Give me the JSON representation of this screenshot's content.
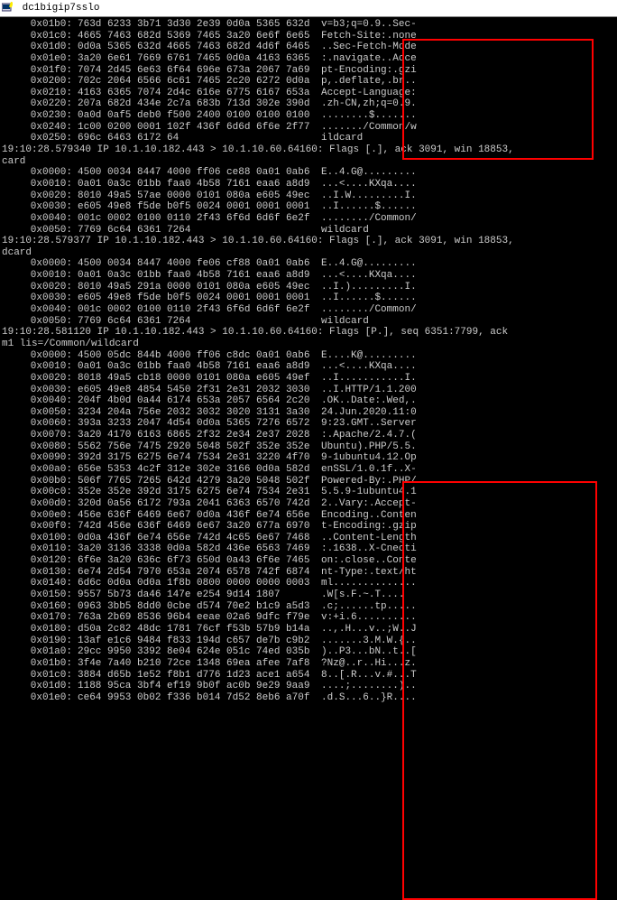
{
  "window": {
    "title": "dc1bigip7sslo"
  },
  "rows": [
    {
      "off": "0x01b0:",
      "hex": "763d 6233 3b71 3d30 2e39 0d0a 5365 632d",
      "asc": "v=b3;q=0.9..Sec-"
    },
    {
      "off": "0x01c0:",
      "hex": "4665 7463 682d 5369 7465 3a20 6e6f 6e65",
      "asc": "Fetch-Site:.none"
    },
    {
      "off": "0x01d0:",
      "hex": "0d0a 5365 632d 4665 7463 682d 4d6f 6465",
      "asc": "..Sec-Fetch-Mode"
    },
    {
      "off": "0x01e0:",
      "hex": "3a20 6e61 7669 6761 7465 0d0a 4163 6365",
      "asc": ":.navigate..Acce"
    },
    {
      "off": "0x01f0:",
      "hex": "7074 2d45 6e63 6f64 696e 673a 2067 7a69",
      "asc": "pt-Encoding:.gzi"
    },
    {
      "off": "0x0200:",
      "hex": "702c 2064 6566 6c61 7465 2c20 6272 0d0a",
      "asc": "p,.deflate,.br.."
    },
    {
      "off": "0x0210:",
      "hex": "4163 6365 7074 2d4c 616e 6775 6167 653a",
      "asc": "Accept-Language:"
    },
    {
      "off": "0x0220:",
      "hex": "207a 682d 434e 2c7a 683b 713d 302e 390d",
      "asc": ".zh-CN,zh;q=0.9."
    },
    {
      "off": "0x0230:",
      "hex": "0a0d 0af5 deb0 f500 2400 0100 0100 0100",
      "asc": "........$......."
    },
    {
      "off": "0x0240:",
      "hex": "1c00 0200 0001 102f 436f 6d6d 6f6e 2f77",
      "asc": "......./Common/w"
    },
    {
      "off": "0x0250:",
      "hex": "696c 6463 6172 64",
      "asc": "ildcard"
    },
    {
      "summary": "19:10:28.579340 IP 10.1.10.182.443 > 10.1.10.60.64160: Flags [.], ack 3091, win 18853,"
    },
    {
      "summary": "card"
    },
    {
      "off": "0x0000:",
      "hex": "4500 0034 8447 4000 ff06 ce88 0a01 0ab6",
      "asc": "E..4.G@........."
    },
    {
      "off": "0x0010:",
      "hex": "0a01 0a3c 01bb faa0 4b58 7161 eaa6 a8d9",
      "asc": "...<....KXqa...."
    },
    {
      "off": "0x0020:",
      "hex": "8010 49a5 57ae 0000 0101 080a e605 49ec",
      "asc": "..I.W.........I."
    },
    {
      "off": "0x0030:",
      "hex": "e605 49e8 f5de b0f5 0024 0001 0001 0001",
      "asc": "..I......$......"
    },
    {
      "off": "0x0040:",
      "hex": "001c 0002 0100 0110 2f43 6f6d 6d6f 6e2f",
      "asc": "......../Common/"
    },
    {
      "off": "0x0050:",
      "hex": "7769 6c64 6361 7264",
      "asc": "wildcard"
    },
    {
      "summary": "19:10:28.579377 IP 10.1.10.182.443 > 10.1.10.60.64160: Flags [.], ack 3091, win 18853,"
    },
    {
      "summary": "dcard"
    },
    {
      "off": "0x0000:",
      "hex": "4500 0034 8447 4000 fe06 cf88 0a01 0ab6",
      "asc": "E..4.G@........."
    },
    {
      "off": "0x0010:",
      "hex": "0a01 0a3c 01bb faa0 4b58 7161 eaa6 a8d9",
      "asc": "...<....KXqa...."
    },
    {
      "off": "0x0020:",
      "hex": "8010 49a5 291a 0000 0101 080a e605 49ec",
      "asc": "..I.).........I."
    },
    {
      "off": "0x0030:",
      "hex": "e605 49e8 f5de b0f5 0024 0001 0001 0001",
      "asc": "..I......$......"
    },
    {
      "off": "0x0040:",
      "hex": "001c 0002 0100 0110 2f43 6f6d 6d6f 6e2f",
      "asc": "......../Common/"
    },
    {
      "off": "0x0050:",
      "hex": "7769 6c64 6361 7264",
      "asc": "wildcard"
    },
    {
      "summary": "19:10:28.581120 IP 10.1.10.182.443 > 10.1.10.60.64160: Flags [P.], seq 6351:7799, ack"
    },
    {
      "summary": "m1 lis=/Common/wildcard"
    },
    {
      "off": "0x0000:",
      "hex": "4500 05dc 844b 4000 ff06 c8dc 0a01 0ab6",
      "asc": "E....K@........."
    },
    {
      "off": "0x0010:",
      "hex": "0a01 0a3c 01bb faa0 4b58 7161 eaa6 a8d9",
      "asc": "...<....KXqa...."
    },
    {
      "off": "0x0020:",
      "hex": "8018 49a5 cb18 0000 0101 080a e605 49ef",
      "asc": "..I...........I."
    },
    {
      "off": "0x0030:",
      "hex": "e605 49e8 4854 5450 2f31 2e31 2032 3030",
      "asc": "..I.HTTP/1.1.200"
    },
    {
      "off": "0x0040:",
      "hex": "204f 4b0d 0a44 6174 653a 2057 6564 2c20",
      "asc": ".OK..Date:.Wed,."
    },
    {
      "off": "0x0050:",
      "hex": "3234 204a 756e 2032 3032 3020 3131 3a30",
      "asc": "24.Jun.2020.11:0"
    },
    {
      "off": "0x0060:",
      "hex": "393a 3233 2047 4d54 0d0a 5365 7276 6572",
      "asc": "9:23.GMT..Server"
    },
    {
      "off": "0x0070:",
      "hex": "3a20 4170 6163 6865 2f32 2e34 2e37 2028",
      "asc": ":.Apache/2.4.7.("
    },
    {
      "off": "0x0080:",
      "hex": "5562 756e 7475 2920 5048 502f 352e 352e",
      "asc": "Ubuntu).PHP/5.5."
    },
    {
      "off": "0x0090:",
      "hex": "392d 3175 6275 6e74 7534 2e31 3220 4f70",
      "asc": "9-1ubuntu4.12.Op"
    },
    {
      "off": "0x00a0:",
      "hex": "656e 5353 4c2f 312e 302e 3166 0d0a 582d",
      "asc": "enSSL/1.0.1f..X-"
    },
    {
      "off": "0x00b0:",
      "hex": "506f 7765 7265 642d 4279 3a20 5048 502f",
      "asc": "Powered-By:.PHP/"
    },
    {
      "off": "0x00c0:",
      "hex": "352e 352e 392d 3175 6275 6e74 7534 2e31",
      "asc": "5.5.9-1ubuntu4.1"
    },
    {
      "off": "0x00d0:",
      "hex": "320d 0a56 6172 793a 2041 6363 6570 742d",
      "asc": "2..Vary:.Accept-"
    },
    {
      "off": "0x00e0:",
      "hex": "456e 636f 6469 6e67 0d0a 436f 6e74 656e",
      "asc": "Encoding..Conten"
    },
    {
      "off": "0x00f0:",
      "hex": "742d 456e 636f 6469 6e67 3a20 677a 6970",
      "asc": "t-Encoding:.gzip"
    },
    {
      "off": "0x0100:",
      "hex": "0d0a 436f 6e74 656e 742d 4c65 6e67 7468",
      "asc": "..Content-Length"
    },
    {
      "off": "0x0110:",
      "hex": "3a20 3136 3338 0d0a 582d 436e 6563 7469",
      "asc": ":.1638..X-Cnecti"
    },
    {
      "off": "0x0120:",
      "hex": "6f6e 3a20 636c 6f73 650d 0a43 6f6e 7465",
      "asc": "on:.close..Conte"
    },
    {
      "off": "0x0130:",
      "hex": "6e74 2d54 7970 653a 2074 6578 742f 6874",
      "asc": "nt-Type:.text/ht"
    },
    {
      "off": "0x0140:",
      "hex": "6d6c 0d0a 0d0a 1f8b 0800 0000 0000 0003",
      "asc": "ml.............."
    },
    {
      "off": "0x0150:",
      "hex": "9557 5b73 da46 147e e254 9d14 1807",
      "asc": ".W[s.F.~.T...."
    },
    {
      "off": "0x0160:",
      "hex": "0963 3bb5 8dd0 0cbe d574 70e2 b1c9 a5d3",
      "asc": ".c;......tp....."
    },
    {
      "off": "0x0170:",
      "hex": "763a 2b69 8536 96b4 eeae 02a6 9dfc f79e",
      "asc": "v:+i.6.........."
    },
    {
      "off": "0x0180:",
      "hex": "d50a 2c82 48dc 1781 76cf f53b 57b9 b14a",
      "asc": "..,.H...v..;W..J"
    },
    {
      "off": "0x0190:",
      "hex": "13af e1c6 9484 f833 194d c657 de7b c9b2",
      "asc": ".......3.M.W.{.."
    },
    {
      "off": "0x01a0:",
      "hex": "29cc 9950 3392 8e04 624e 051c 74ed 035b",
      "asc": ")..P3...bN..t..["
    },
    {
      "off": "0x01b0:",
      "hex": "3f4e 7a40 b210 72ce 1348 69ea afee 7af8",
      "asc": "?Nz@..r..Hi...z."
    },
    {
      "off": "0x01c0:",
      "hex": "3884 d65b 1e52 f8b1 d776 1d23 ace1 a654",
      "asc": "8..[.R...v.#...T"
    },
    {
      "off": "0x01d0:",
      "hex": "1188 95ca 3bf4 ef19 9b0f ac0b 9e29 9aa9",
      "asc": "....;........).."
    },
    {
      "off": "0x01e0:",
      "hex": "ce64 9953 0b02 f336 b014 7d52 8eb6 a70f",
      "asc": ".d.S...6..}R...."
    }
  ]
}
